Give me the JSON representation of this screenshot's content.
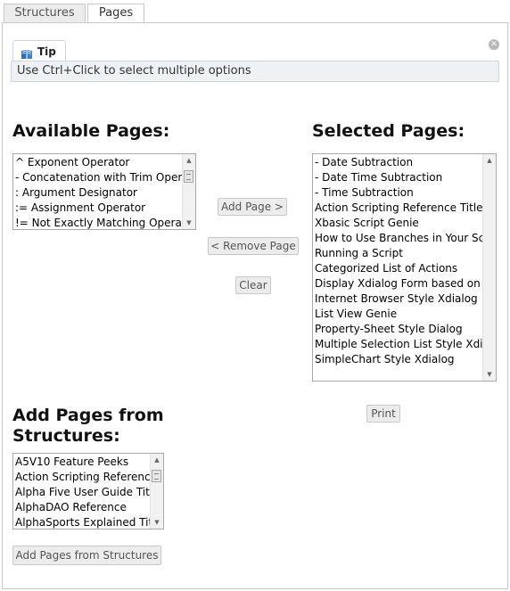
{
  "tabs": [
    {
      "label": "Structures",
      "active": false
    },
    {
      "label": "Pages",
      "active": true
    }
  ],
  "tip": {
    "title": "Tip",
    "icon": "book-icon",
    "message": "Use Ctrl+Click to select multiple options",
    "close_icon": "close-icon"
  },
  "available_pages": {
    "heading": "Available Pages:",
    "items": [
      "^ Exponent Operator",
      "- Concatenation with Trim Operator",
      ": Argument Designator",
      ":= Assignment Operator",
      "!= Not Exactly Matching Operator"
    ]
  },
  "selected_pages": {
    "heading": "Selected Pages:",
    "items": [
      "- Date Subtraction",
      "- Date Time Subtraction",
      "- Time Subtraction",
      "Action Scripting Reference Title",
      "Xbasic Script Genie",
      "How to Use Branches in Your Script",
      "Running a Script",
      "Categorized List of Actions",
      "Display Xdialog Form based on Action",
      "Internet Browser Style Xdialog",
      "List View Genie",
      "Property-Sheet Style Dialog",
      "Multiple Selection List Style Xdialog",
      "SimpleChart Style Xdialog"
    ]
  },
  "buttons": {
    "add_page": "Add Page >",
    "remove_page": "< Remove Page",
    "clear": "Clear",
    "print": "Print",
    "add_from_structures": "Add Pages from Structures"
  },
  "structures": {
    "heading_line1": "Add Pages from",
    "heading_line2": "Structures:",
    "items": [
      "A5V10 Feature Peeks",
      "Action Scripting Reference",
      "Alpha Five User Guide Title",
      "AlphaDAO Reference",
      "AlphaSports Explained Title"
    ]
  },
  "colors": {
    "tip_bar_bg": "#eef2f5",
    "button_bg": "#ececec",
    "border": "#c9c9c9"
  }
}
